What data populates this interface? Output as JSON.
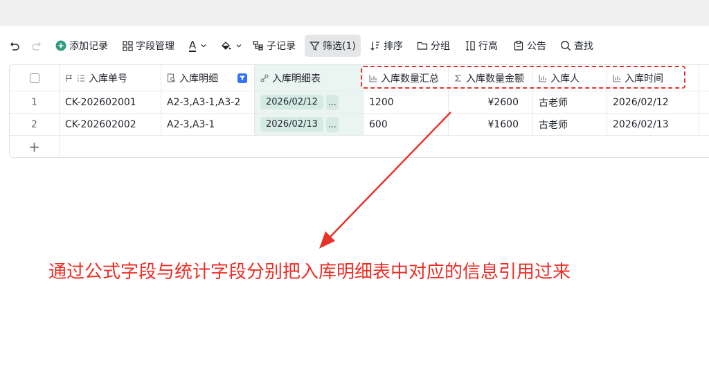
{
  "toolbar": {
    "add_record": "添加记录",
    "field_manage": "字段管理",
    "text_a": "A",
    "sub_record": "子记录",
    "filter": "筛选(1)",
    "sort": "排序",
    "group": "分组",
    "row_height": "行高",
    "notice": "公告",
    "search": "查找"
  },
  "table": {
    "columns": [
      "入库单号",
      "入库明细",
      "入库明细表",
      "入库数量汇总",
      "入库数量金额",
      "入库人",
      "入库时间"
    ],
    "rows": [
      {
        "index": "1",
        "order_no": "CK-202602001",
        "detail": "A2-3,A3-1,A3-2",
        "detail_table": "2026/02/12",
        "more": "...",
        "qty_total": "1200",
        "amount": "¥2600",
        "person": "古老师",
        "time": "2026/02/12"
      },
      {
        "index": "2",
        "order_no": "CK-202602002",
        "detail": "A2-3,A3-1",
        "detail_table": "2026/02/13",
        "more": "...",
        "qty_total": "600",
        "amount": "¥1600",
        "person": "古老师",
        "time": "2026/02/13"
      }
    ],
    "add_row": "+"
  },
  "annotation": {
    "caption": "通过公式字段与统计字段分别把入库明细表中对应的信息引用过来",
    "color": "#ee2c24"
  }
}
